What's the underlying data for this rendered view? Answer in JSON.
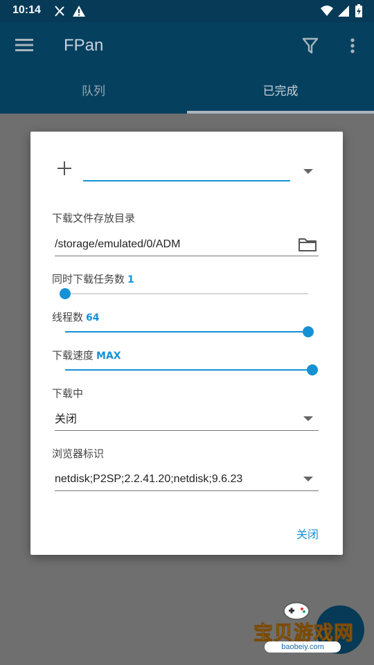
{
  "status_bar": {
    "time": "10:14"
  },
  "app_bar": {
    "title": "FPan"
  },
  "tabs": [
    {
      "label": "队列",
      "selected": false
    },
    {
      "label": "已完成",
      "selected": true
    }
  ],
  "dialog": {
    "url_input": {
      "value": ""
    },
    "download_dir": {
      "label": "下载文件存放目录",
      "value": "/storage/emulated/0/ADM"
    },
    "concurrent_tasks": {
      "label": "同时下载任务数",
      "value": "1",
      "level": 0
    },
    "threads": {
      "label": "线程数",
      "value": "64",
      "level": 1
    },
    "speed": {
      "label": "下载速度",
      "value": "MAX",
      "level": 1
    },
    "downloading": {
      "label": "下载中",
      "selected": "关闭"
    },
    "user_agent": {
      "label": "浏览器标识",
      "selected": "netdisk;P2SP;2.2.41.20;netdisk;9.6.23"
    },
    "close_button": "关闭"
  },
  "watermark": {
    "text": "宝贝游戏网",
    "url": "baobeiy.com"
  },
  "colors": {
    "accent": "#1591d6",
    "app_bar": "#06405f",
    "status_bar": "#063a56",
    "scrim": "#6f6f6f"
  }
}
